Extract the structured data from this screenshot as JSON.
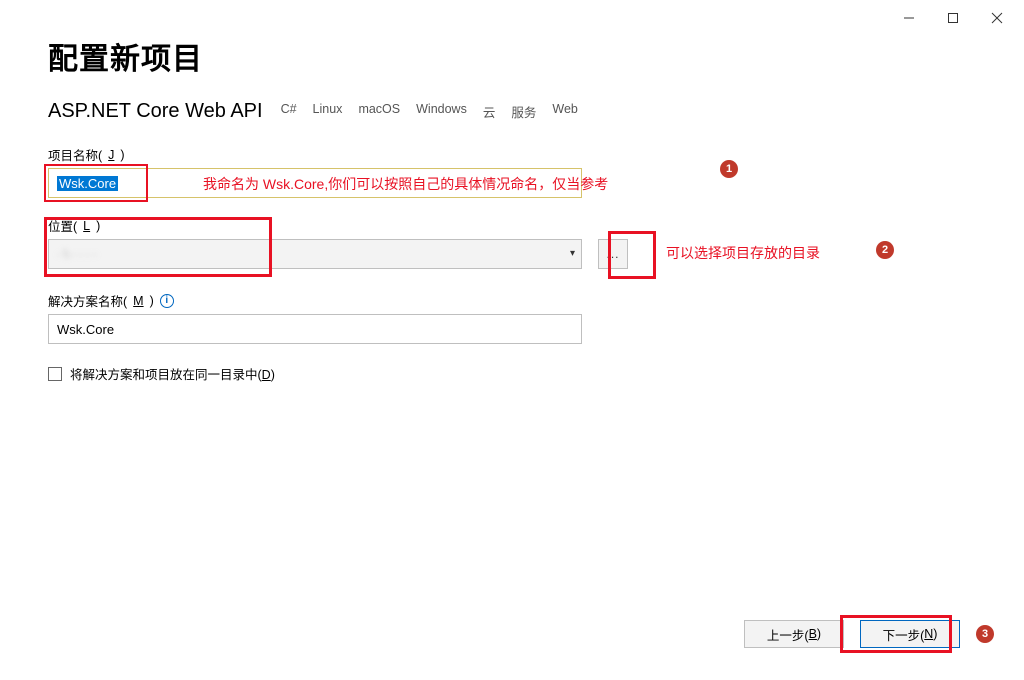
{
  "window": {
    "title": "配置新项目",
    "subtitle": "ASP.NET Core Web API",
    "tags": [
      "C#",
      "Linux",
      "macOS",
      "Windows",
      "云",
      "服务",
      "Web"
    ]
  },
  "fields": {
    "project_label": "项目名称(",
    "project_shortcut": "J",
    "project_label_end": ")",
    "project_value": "Wsk.Core",
    "location_label": "位置(",
    "location_shortcut": "L",
    "location_label_end": ")",
    "location_value": "· \\ · · · ·",
    "browse_label": "...",
    "solution_label": "解决方案名称(",
    "solution_shortcut": "M",
    "solution_label_end": ")",
    "solution_value": "Wsk.Core",
    "same_dir_label": "将解决方案和项目放在同一目录中(",
    "same_dir_shortcut": "D",
    "same_dir_label_end": ")"
  },
  "buttons": {
    "back": "上一步(",
    "back_shortcut": "B",
    "back_end": ")",
    "next": "下一步(",
    "next_shortcut": "N",
    "next_end": ")"
  },
  "annotations": {
    "a1": "我命名为 Wsk.Core,你们可以按照自己的具体情况命名，仅当参考",
    "a2": "可以选择项目存放的目录",
    "b1": "1",
    "b2": "2",
    "b3": "3"
  }
}
